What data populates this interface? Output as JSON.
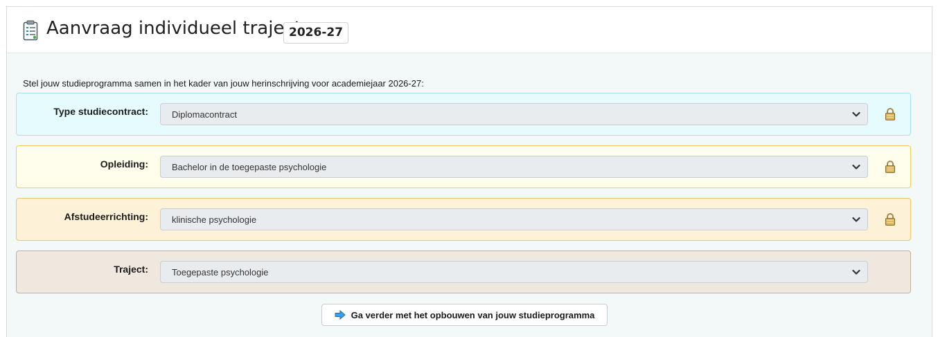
{
  "header": {
    "title": "Aanvraag individueel traject",
    "year_badge": "2026-27",
    "icon": "clipboard-icon"
  },
  "intro": "Stel jouw studieprogramma samen in het kader van jouw herinschrijving voor academiejaar 2026-27:",
  "fields": [
    {
      "label": "Type studiecontract:",
      "value": "Diplomacontract",
      "locked": true,
      "color": "#e6fbfd"
    },
    {
      "label": "Opleiding:",
      "value": "Bachelor in de toegepaste psychologie",
      "locked": true,
      "color": "#fffdeb"
    },
    {
      "label": "Afstudeerrichting:",
      "value": "klinische psychologie",
      "locked": true,
      "color": "#fdf1d8"
    },
    {
      "label": "Traject:",
      "value": "Toegepaste psychologie",
      "locked": false,
      "color": "#efe8de"
    }
  ],
  "continue_button": {
    "label": "Ga verder met het opbouwen van jouw studieprogramma",
    "icon": "arrow-right-icon"
  }
}
